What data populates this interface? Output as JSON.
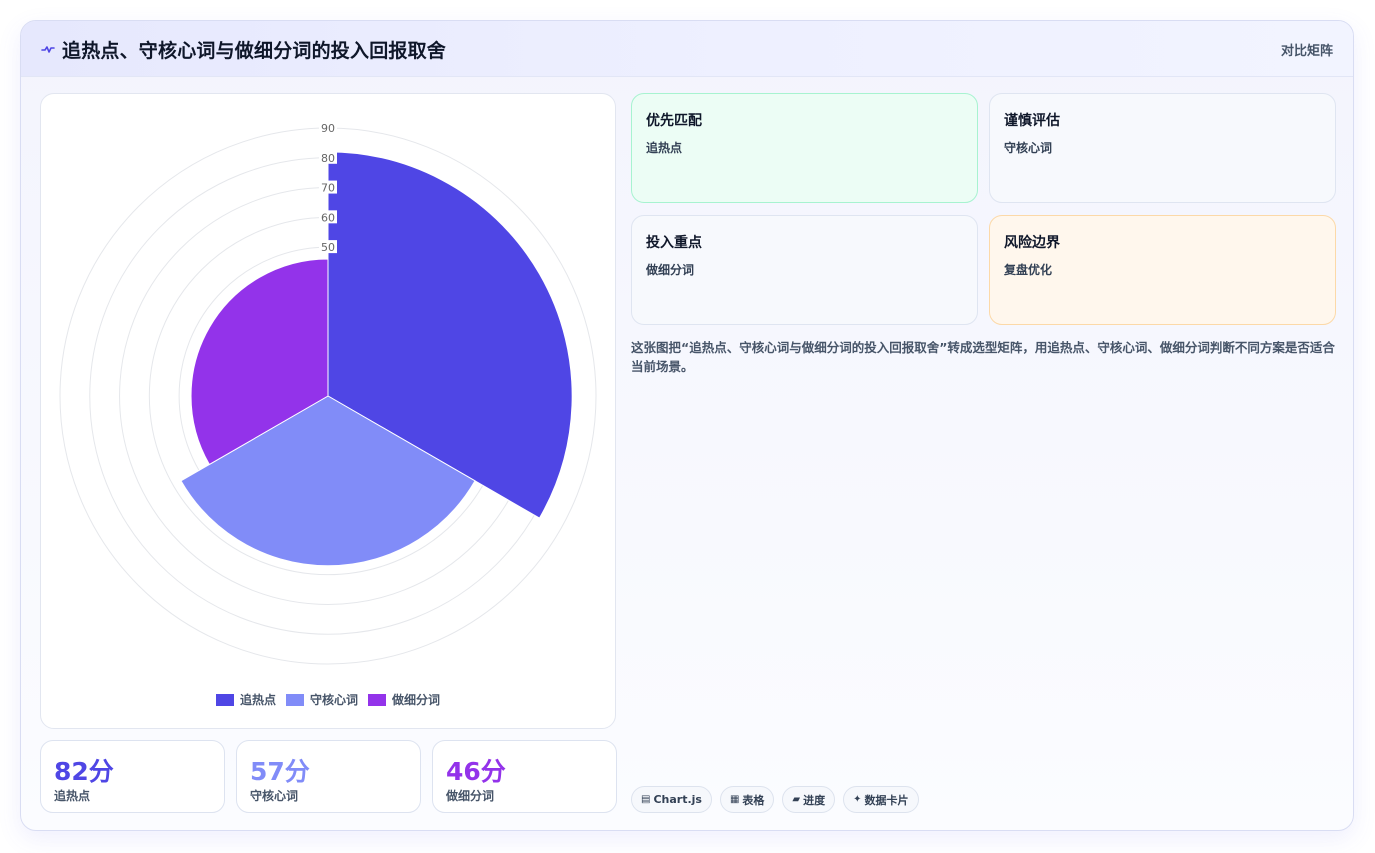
{
  "header": {
    "title": "追热点、守核心词与做细分词的投入回报取舍",
    "mode_label": "对比矩阵",
    "icon": "pulse-icon"
  },
  "chart_data": {
    "type": "polarArea",
    "categories": [
      "追热点",
      "守核心词",
      "做细分词"
    ],
    "values": [
      82,
      57,
      46
    ],
    "colors": [
      "#4f46e5",
      "#818cf8",
      "#9333ea"
    ],
    "r_ticks": [
      50,
      60,
      70,
      80,
      90
    ],
    "r_max": 90,
    "grid": true,
    "legend": "bottom"
  },
  "stats": [
    {
      "value": "82分",
      "label": "追热点",
      "color": "#4f46e5"
    },
    {
      "value": "57分",
      "label": "守核心词",
      "color": "#818cf8"
    },
    {
      "value": "46分",
      "label": "做细分词",
      "color": "#9333ea"
    }
  ],
  "tiles": [
    {
      "title": "优先匹配",
      "value": "追热点",
      "bg": "#ecfdf5",
      "border": "#a7f3d0"
    },
    {
      "title": "谨慎评估",
      "value": "守核心词",
      "bg": "#f7f9fd",
      "border": "#dfe5f1"
    },
    {
      "title": "投入重点",
      "value": "做细分词",
      "bg": "#f7f9fd",
      "border": "#dfe5f1"
    },
    {
      "title": "风险边界",
      "value": "复盘优化",
      "bg": "#fff7ed",
      "border": "#fcd9a8"
    }
  ],
  "description": "这张图把“追热点、守核心词与做细分词的投入回报取舍”转成选型矩阵，用追热点、守核心词、做细分词判断不同方案是否适合当前场景。",
  "tags": [
    {
      "icon": "chart-icon",
      "label": "Chart.js"
    },
    {
      "icon": "table-icon",
      "label": "表格"
    },
    {
      "icon": "progress-icon",
      "label": "进度"
    },
    {
      "icon": "sparkle-icon",
      "label": "数据卡片"
    }
  ]
}
